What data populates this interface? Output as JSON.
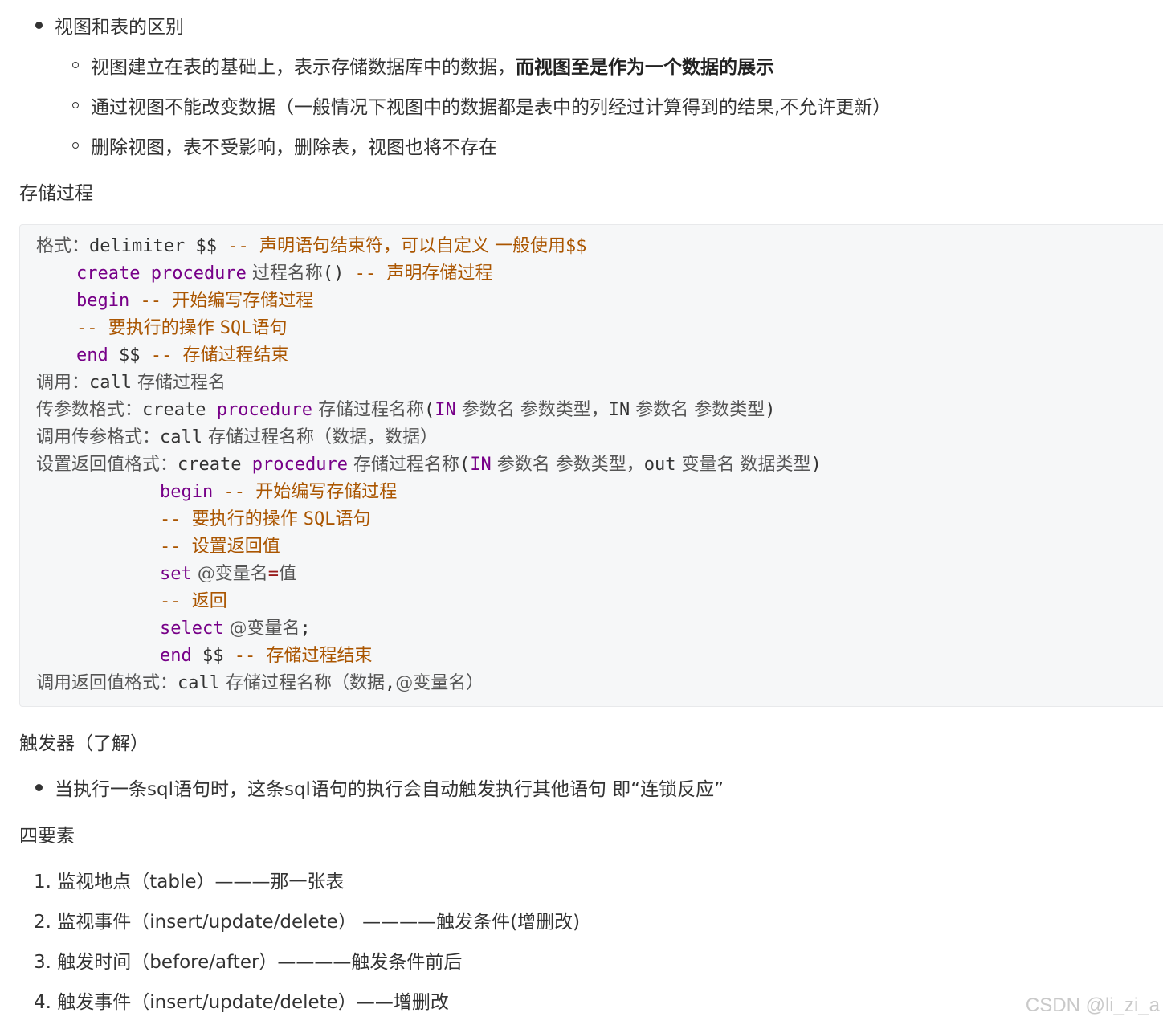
{
  "section1": {
    "bullet": "视图和表的区别",
    "sub": [
      {
        "text": "视图建立在表的基础上，表示存储数据库中的数据，",
        "bold": "而视图至是作为一个数据的展示"
      },
      {
        "text": "通过视图不能改变数据（一般情况下视图中的数据都是表中的列经过计算得到的结果,不允许更新）",
        "bold": ""
      },
      {
        "text": "删除视图，表不受影响，删除表，视图也将不存在",
        "bold": ""
      }
    ]
  },
  "heading_procedure": "存储过程",
  "code": {
    "l1": {
      "a": "格式：",
      "b": "delimiter $$ ",
      "c": "-- ",
      "d": "声明语句结束符，可以自定义 一般使用",
      "e": "$$"
    },
    "l2": {
      "a": "create procedure",
      "b": " 过程名称",
      "c": "()",
      "d": " -- ",
      "e": "声明存储过程"
    },
    "l3": {
      "a": "begin",
      "b": " -- ",
      "c": "开始编写存储过程"
    },
    "l4": {
      "a": "-- ",
      "b": "要执行的操作 ",
      "c": "SQL",
      "d": "语句"
    },
    "l5": {
      "a": "end",
      "b": " $$ ",
      "c": "-- ",
      "d": "存储过程结束"
    },
    "l6": {
      "a": "调用：",
      "b": "call",
      "c": " 存储过程名"
    },
    "l7": {
      "a": "传参数格式：",
      "b": "create ",
      "c": "procedure",
      "d": " 存储过程名称",
      "e": "(",
      "f": "IN",
      "g": " 参数名 参数类型，",
      "h": "IN",
      "i": " 参数名 参数类型",
      "j": ")"
    },
    "l8": {
      "a": "调用传参格式：",
      "b": "call",
      "c": " 存储过程名称（数据，数据）"
    },
    "l9": {
      "a": "设置返回值格式：",
      "b": "create ",
      "c": "procedure",
      "d": " 存储过程名称",
      "e": "(",
      "f": "IN",
      "g": " 参数名 参数类型，",
      "h": "out",
      "i": " 变量名 数据类型",
      "j": ")"
    },
    "l10": {
      "a": "begin",
      "b": " -- ",
      "c": "开始编写存储过程"
    },
    "l11": {
      "a": "-- ",
      "b": "要执行的操作 ",
      "c": "SQL",
      "d": "语句"
    },
    "l12": {
      "a": "-- ",
      "b": "设置返回值"
    },
    "l13": {
      "a": "set",
      "b": " @变量名",
      "c": "=",
      "d": "值"
    },
    "l14": {
      "a": "-- ",
      "b": "返回"
    },
    "l15": {
      "a": "select",
      "b": " @变量名",
      "c": ";"
    },
    "l16": {
      "a": "end",
      "b": " $$ ",
      "c": "-- ",
      "d": "存储过程结束"
    },
    "l17": {
      "a": "调用返回值格式：",
      "b": "call",
      "c": " 存储过程名称（数据",
      "d": ",",
      "e": "@变量名）"
    }
  },
  "heading_trigger": "触发器（了解）",
  "trigger_bullet": "当执行一条sql语句时，这条sql语句的执行会自动触发执行其他语句 即“连锁反应”",
  "heading_elements": "四要素",
  "elements": [
    "1. 监视地点（table）———那一张表",
    "2. 监视事件（insert/update/delete） ————触发条件(增删改)",
    "3. 触发时间（before/after）————触发条件前后",
    "4. 触发事件（insert/update/delete）——增删改"
  ],
  "watermark": "CSDN @li_zi_a",
  "colors": {
    "keyword": "#770088",
    "comment": "#aa5500",
    "text": "#333333",
    "code_bg": "#f6f7f8"
  }
}
